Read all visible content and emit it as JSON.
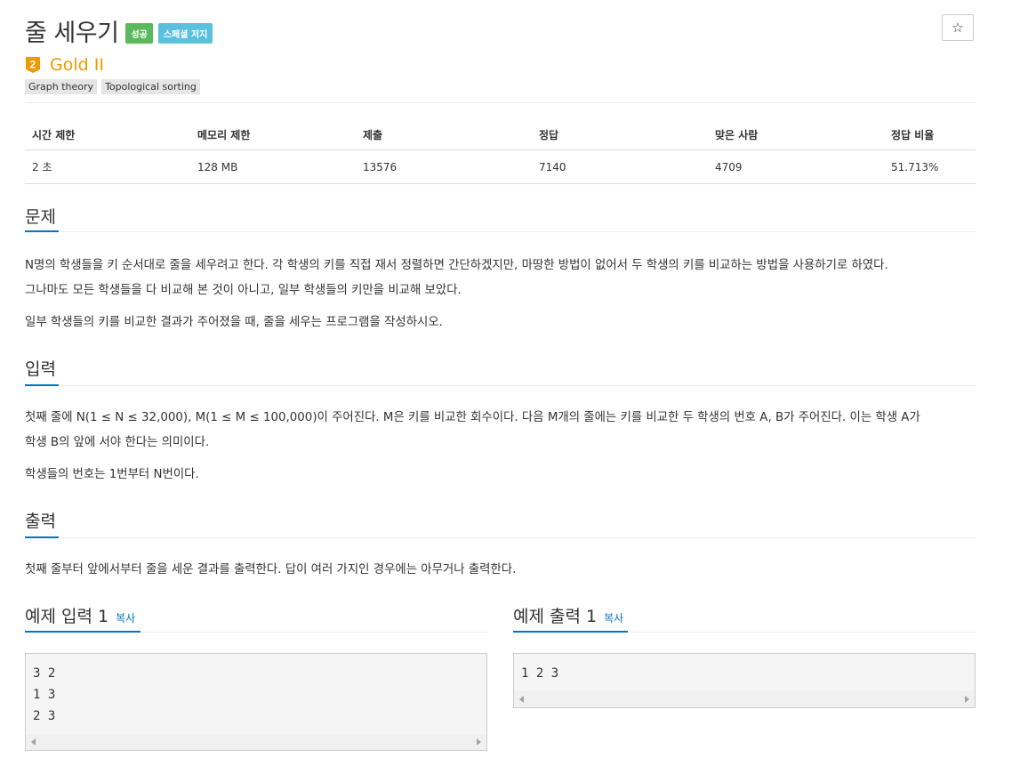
{
  "problem": {
    "title": "줄 세우기",
    "badges": [
      {
        "label": "성공",
        "color": "#5cb85c"
      },
      {
        "label": "스페셜 저지",
        "color": "#5bc0de"
      }
    ],
    "star_icon": "star-icon",
    "tier": {
      "number": "2",
      "label": "Gold II",
      "color": "#ec9a00"
    },
    "tags": [
      "Graph theory",
      "Topological sorting"
    ]
  },
  "info_table": {
    "headers": [
      "시간 제한",
      "메모리 제한",
      "제출",
      "정답",
      "맞은 사람",
      "정답 비율"
    ],
    "row": [
      "2 초",
      "128 MB",
      "13576",
      "7140",
      "4709",
      "51.713%"
    ]
  },
  "sections": {
    "description": {
      "heading": "문제",
      "lines": [
        "N명의 학생들을 키 순서대로 줄을 세우려고 한다. 각 학생의 키를 직접 재서 정렬하면 간단하겠지만, 마땅한 방법이 없어서 두 학생의 키를 비교하는 방법을 사용하기로 하였다.",
        "그나마도 모든 학생들을 다 비교해 본 것이 아니고, 일부 학생들의 키만을 비교해 보았다.",
        "일부 학생들의 키를 비교한 결과가 주어졌을 때, 줄을 세우는 프로그램을 작성하시오."
      ]
    },
    "input": {
      "heading": "입력",
      "lines": [
        "첫째 줄에 N(1 ≤ N ≤ 32,000), M(1 ≤ M ≤ 100,000)이 주어진다. M은 키를 비교한 회수이다. 다음 M개의 줄에는 키를 비교한 두 학생의 번호 A, B가 주어진다. 이는 학생 A가",
        "학생 B의 앞에 서야 한다는 의미이다.",
        "학생들의 번호는 1번부터 N번이다."
      ]
    },
    "output": {
      "heading": "출력",
      "lines": [
        "첫째 줄부터 앞에서부터 줄을 세운 결과를 출력한다. 답이 여러 가지인 경우에는 아무거나 출력한다."
      ]
    }
  },
  "samples": {
    "input": {
      "heading": "예제 입력 1",
      "copy_label": "복사",
      "lines": [
        "3 2",
        "1 3",
        "2 3"
      ]
    },
    "output": {
      "heading": "예제 출력 1",
      "copy_label": "복사",
      "lines": [
        "1 2 3"
      ]
    }
  }
}
